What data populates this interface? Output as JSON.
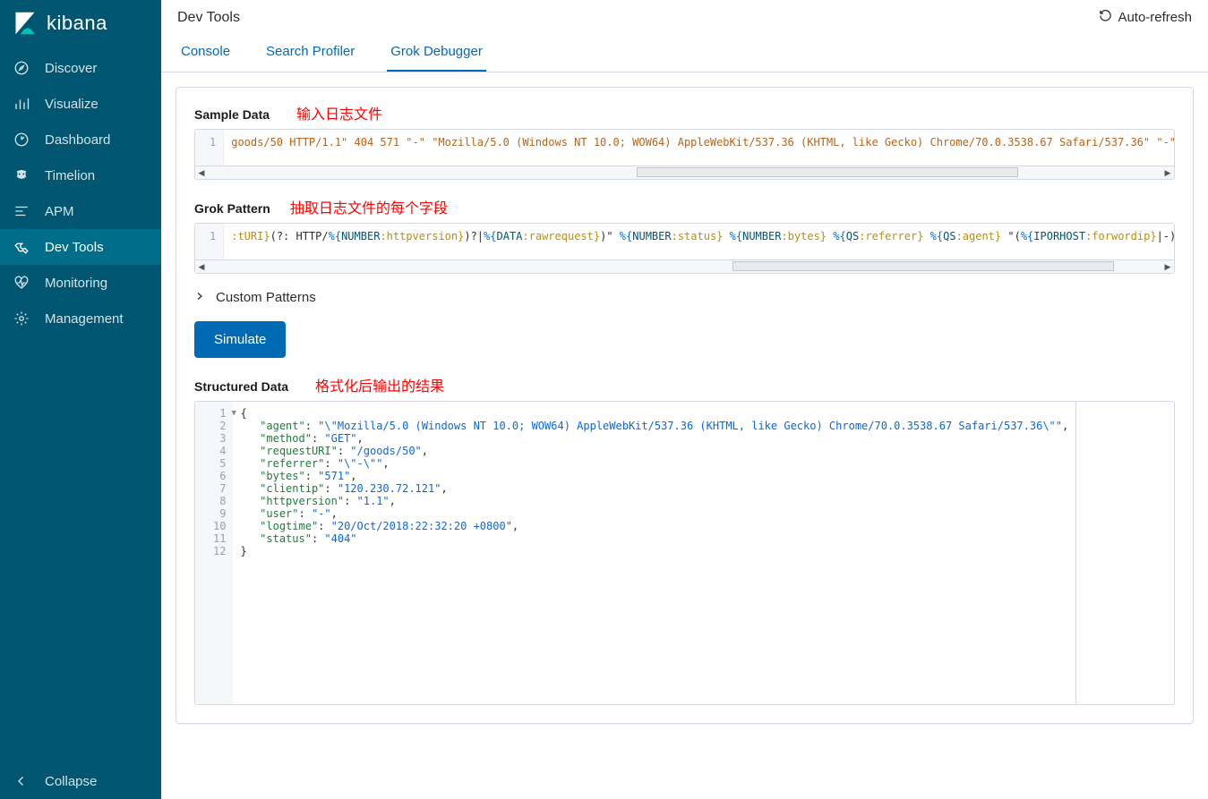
{
  "brand": "kibana",
  "nav": {
    "items": [
      {
        "label": "Discover"
      },
      {
        "label": "Visualize"
      },
      {
        "label": "Dashboard"
      },
      {
        "label": "Timelion"
      },
      {
        "label": "APM"
      },
      {
        "label": "Dev Tools"
      },
      {
        "label": "Monitoring"
      },
      {
        "label": "Management"
      }
    ],
    "collapse": "Collapse"
  },
  "topbar": {
    "title": "Dev Tools",
    "auto_refresh": "Auto-refresh"
  },
  "tabs": [
    {
      "label": "Console"
    },
    {
      "label": "Search Profiler"
    },
    {
      "label": "Grok Debugger"
    }
  ],
  "labels": {
    "sample_data": "Sample Data",
    "grok_pattern": "Grok Pattern",
    "custom_patterns": "Custom Patterns",
    "structured_data": "Structured Data",
    "simulate": "Simulate"
  },
  "annotations": {
    "sample": "输入日志文件",
    "pattern": "抽取日志文件的每个字段",
    "output": "格式化后输出的结果"
  },
  "sample_line_no": "1",
  "sample_data_text": "goods/50 HTTP/1.1\" 404 571 \"-\" \"Mozilla/5.0 (Windows NT 10.0; WOW64) AppleWebKit/537.36 (KHTML, like Gecko) Chrome/70.0.3538.67 Safari/537.36\" \"-\"",
  "grok_line_no": "1",
  "grok": {
    "p1": ":tURI}",
    "p2": "(?: HTTP/",
    "p3": "%{",
    "p4": "NUMBER",
    "p5": ":httpversion}",
    "p6": ")?|",
    "p7": "%{",
    "p8": "DATA",
    "p9": ":rawrequest}",
    "p10": ")\" ",
    "p11": "%{",
    "p12": "NUMBER",
    "p13": ":status}",
    "p14": " ",
    "p15": "%{",
    "p16": "NUMBER",
    "p17": ":bytes}",
    "p18": " ",
    "p19": "%{",
    "p20": "QS",
    "p21": ":referrer}",
    "p22": " ",
    "p23": "%{",
    "p24": "QS",
    "p25": ":agent}",
    "p26": " \"(",
    "p27": "%{",
    "p28": "IPORHOST",
    "p29": ":forwordip}",
    "p30": "|-)\""
  },
  "output": {
    "lines": [
      "1",
      "2",
      "3",
      "4",
      "5",
      "6",
      "7",
      "8",
      "9",
      "10",
      "11",
      "12"
    ],
    "open_brace": "{",
    "close_brace": "}",
    "rows": [
      {
        "k": "\"agent\"",
        "v": "\"\\\"Mozilla/5.0 (Windows NT 10.0; WOW64) AppleWebKit/537.36 (KHTML, like Gecko) Chrome/70.0.3538.67 Safari/537.36\\\"\""
      },
      {
        "k": "\"method\"",
        "v": "\"GET\""
      },
      {
        "k": "\"requestURI\"",
        "v": "\"/goods/50\""
      },
      {
        "k": "\"referrer\"",
        "v": "\"\\\"-\\\"\""
      },
      {
        "k": "\"bytes\"",
        "v": "\"571\""
      },
      {
        "k": "\"clientip\"",
        "v": "\"120.230.72.121\""
      },
      {
        "k": "\"httpversion\"",
        "v": "\"1.1\""
      },
      {
        "k": "\"user\"",
        "v": "\"-\""
      },
      {
        "k": "\"logtime\"",
        "v": "\"20/Oct/2018:22:32:20 +0800\""
      },
      {
        "k": "\"status\"",
        "v": "\"404\""
      }
    ]
  }
}
